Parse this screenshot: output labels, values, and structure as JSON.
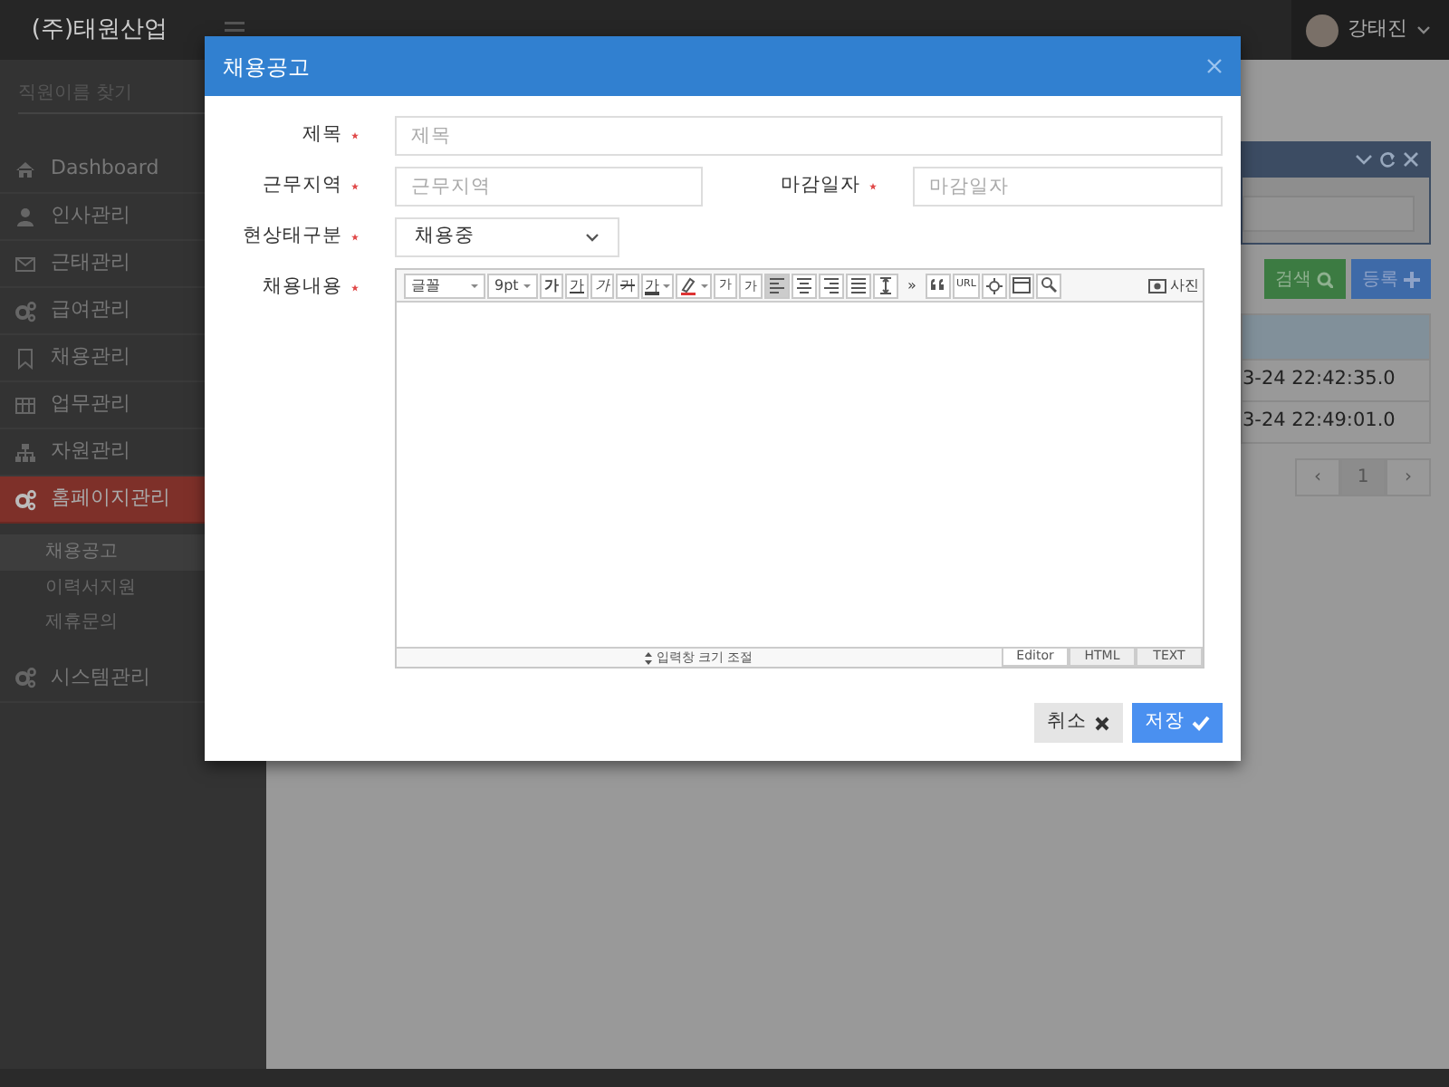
{
  "topbar": {
    "brand": "(주)태원산업",
    "user": {
      "name": "강태진"
    }
  },
  "sidebar": {
    "search": {
      "placeholder": "직원이름 찾기"
    },
    "items": [
      {
        "label": "Dashboard",
        "selected": false
      },
      {
        "label": "인사관리",
        "selected": false
      },
      {
        "label": "근태관리",
        "selected": false
      },
      {
        "label": "급여관리",
        "selected": false
      },
      {
        "label": "채용관리",
        "selected": false
      },
      {
        "label": "업무관리",
        "selected": false
      },
      {
        "label": "자원관리",
        "selected": false
      },
      {
        "label": "홈페이지관리",
        "selected": true,
        "expanded": true,
        "children": [
          {
            "label": "채용공고",
            "selected": true
          },
          {
            "label": "이력서지원",
            "selected": false
          },
          {
            "label": "제휴문의",
            "selected": false
          }
        ]
      },
      {
        "label": "시스템관리",
        "selected": false
      }
    ]
  },
  "background": {
    "buttons": [
      {
        "label": "검색",
        "kind": "search"
      },
      {
        "label": "등록",
        "kind": "add"
      }
    ],
    "rows": [
      "3-24 22:42:35.0",
      "3-24 22:49:01.0"
    ],
    "pagination": [
      {
        "label": "‹",
        "selected": false
      },
      {
        "label": "1",
        "selected": true
      },
      {
        "label": "›",
        "selected": false
      }
    ]
  },
  "modal": {
    "title": "채용공고",
    "rows": [
      [
        {
          "kind": "text",
          "label": "제목",
          "required": true,
          "placeholder": "제목"
        }
      ],
      [
        {
          "kind": "text",
          "label": "근무지역",
          "required": true,
          "placeholder": "근무지역"
        },
        {
          "kind": "text",
          "label": "마감일자",
          "required": true,
          "placeholder": "마감일자"
        }
      ],
      [
        {
          "kind": "select",
          "label": "현상태구분",
          "required": true,
          "value": "채용중"
        }
      ]
    ],
    "editor": {
      "label": "채용내용",
      "required": true,
      "tools": [
        {
          "kind": "select",
          "label": "글꼴"
        },
        {
          "kind": "select",
          "label": "9pt"
        },
        {
          "kind": "bold",
          "label": "가"
        },
        {
          "kind": "underline",
          "label": "가"
        },
        {
          "kind": "italic",
          "label": "가"
        },
        {
          "kind": "strike",
          "label": "가"
        },
        {
          "kind": "color",
          "label": "가"
        },
        {
          "kind": "highlight"
        },
        {
          "kind": "superscript",
          "label": "가"
        },
        {
          "kind": "subscript",
          "label": "가"
        },
        {
          "kind": "alignleft",
          "selected": true
        },
        {
          "kind": "aligncenter",
          "selected": false
        },
        {
          "kind": "alignright",
          "selected": false
        },
        {
          "kind": "justify",
          "selected": false
        },
        {
          "kind": "lineheight",
          "selected": false
        },
        {
          "kind": "more",
          "label": "»"
        },
        {
          "kind": "quote"
        },
        {
          "kind": "link",
          "label": "URL"
        },
        {
          "kind": "symbol"
        },
        {
          "kind": "table"
        },
        {
          "kind": "find"
        }
      ],
      "photo": "사진",
      "resize": "입력창 크기 조절",
      "modes": [
        {
          "label": "Editor",
          "selected": true
        },
        {
          "label": "HTML",
          "selected": false
        },
        {
          "label": "TEXT",
          "selected": false
        }
      ]
    },
    "buttons": [
      {
        "label": "취소",
        "kind": "cancel"
      },
      {
        "label": "저장",
        "kind": "save"
      }
    ]
  }
}
